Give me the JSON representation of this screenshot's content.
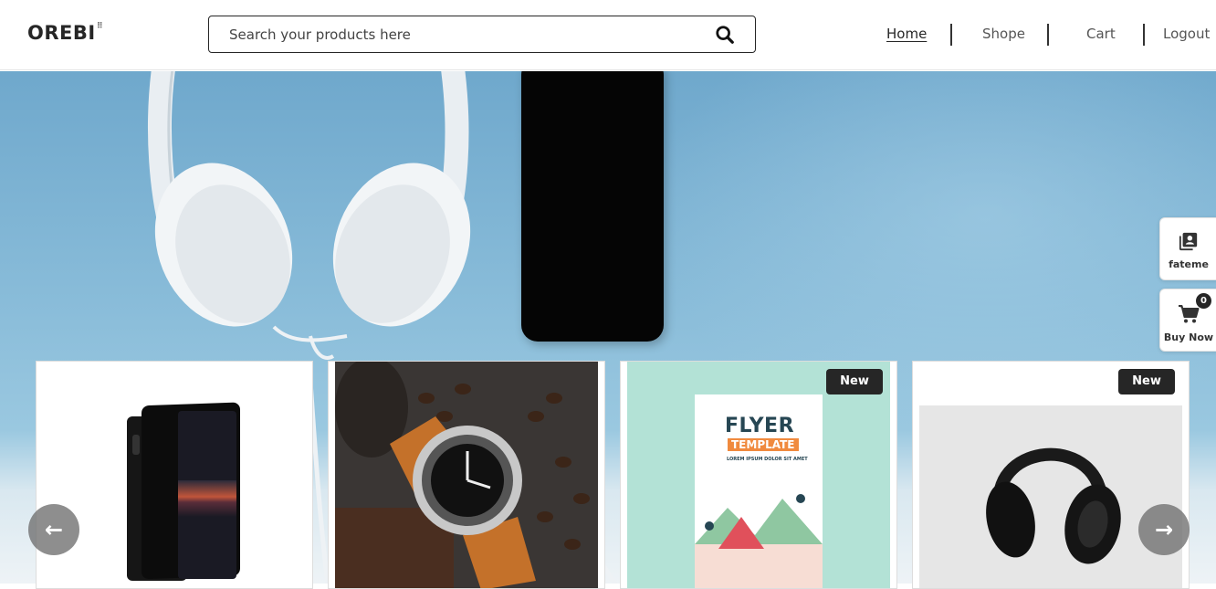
{
  "header": {
    "logo": "OREBI",
    "search_placeholder": "Search your products here",
    "nav": [
      {
        "label": "Home",
        "active": true
      },
      {
        "label": "Shope",
        "active": false
      },
      {
        "label": "Cart",
        "active": false
      },
      {
        "label": "Logout",
        "active": false
      }
    ]
  },
  "side_panel": {
    "profile_label": "fateme",
    "cart_label": "Buy Now",
    "cart_count": "0"
  },
  "products": [
    {
      "image": "smartphone",
      "badge": ""
    },
    {
      "image": "wristwatch",
      "badge": ""
    },
    {
      "image": "flyer-template",
      "badge": "New",
      "flyer_title": "FLYER",
      "flyer_subtitle": "TEMPLATE",
      "flyer_tagline": "LOREM IPSUM DOLOR SIT AMET"
    },
    {
      "image": "headphones",
      "badge": "New"
    }
  ],
  "carousel": {
    "prev_icon": "arrow-left-icon",
    "next_icon": "arrow-right-icon"
  },
  "colors": {
    "brand": "#262626",
    "hero_blue": "#89bcd9",
    "badge_bg": "#262626"
  }
}
